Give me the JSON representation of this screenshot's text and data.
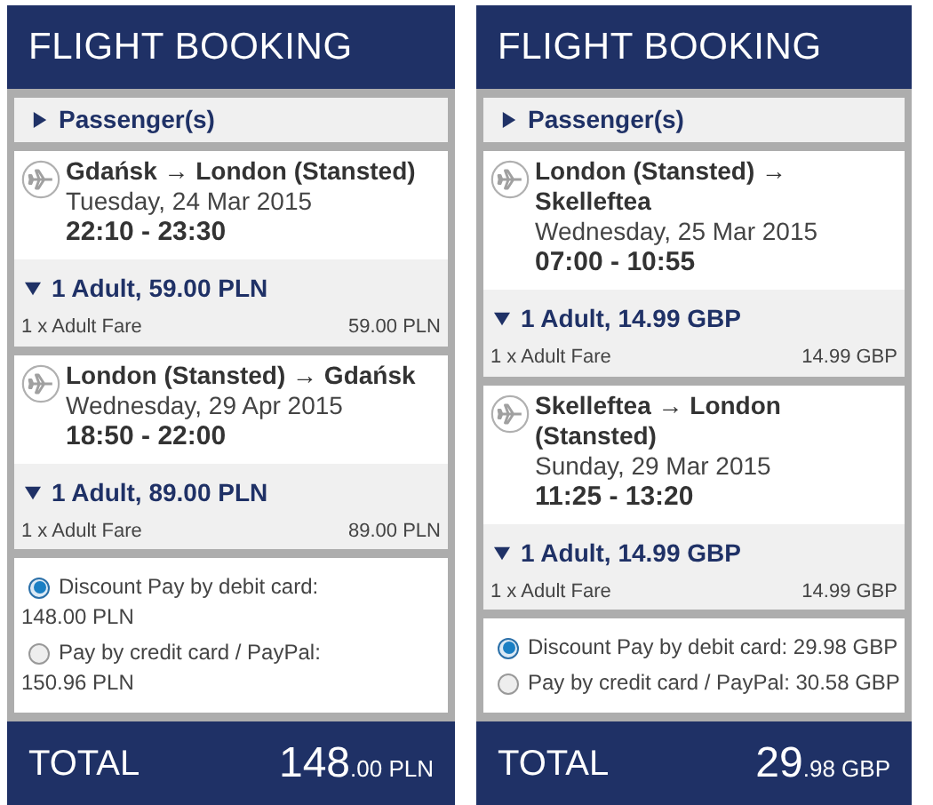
{
  "panels": [
    {
      "title": "FLIGHT BOOKING",
      "passengers": {
        "label": "Passenger(s)",
        "expanded": false
      },
      "flights": [
        {
          "route": "Gdańsk → London (Stansted)",
          "date": "Tuesday, 24 Mar 2015",
          "time": "22:10 - 23:30",
          "fare_summary": "1 Adult, 59.00 PLN",
          "expanded": true,
          "fare_label": "1 x Adult Fare",
          "fare_amount": "59.00 PLN"
        },
        {
          "route": "London (Stansted) → Gdańsk",
          "date": "Wednesday, 29 Apr 2015",
          "time": "18:50 - 22:00",
          "fare_summary": "1 Adult, 89.00 PLN",
          "expanded": true,
          "fare_label": "1 x Adult Fare",
          "fare_amount": "89.00 PLN"
        }
      ],
      "payment_options": [
        {
          "label": "Discount Pay by debit card:",
          "amount": "148.00 PLN",
          "selected": true
        },
        {
          "label": "Pay by credit card / PayPal:",
          "amount": "150.96 PLN",
          "selected": false
        }
      ],
      "total": {
        "label": "TOTAL",
        "amount": "148",
        "fraction": ".00 PLN"
      }
    },
    {
      "title": "FLIGHT BOOKING",
      "passengers": {
        "label": "Passenger(s)",
        "expanded": false
      },
      "flights": [
        {
          "route": "London (Stansted) → Skelleftea",
          "date": "Wednesday, 25 Mar 2015",
          "time": "07:00 - 10:55",
          "fare_summary": "1 Adult, 14.99 GBP",
          "expanded": true,
          "fare_label": "1 x Adult Fare",
          "fare_amount": "14.99 GBP"
        },
        {
          "route": "Skelleftea → London (Stansted)",
          "date": "Sunday, 29 Mar 2015",
          "time": "11:25 - 13:20",
          "fare_summary": "1 Adult, 14.99 GBP",
          "expanded": true,
          "fare_label": "1 x Adult Fare",
          "fare_amount": "14.99 GBP"
        }
      ],
      "payment_options": [
        {
          "label": "Discount Pay by debit card:",
          "amount": "29.98 GBP",
          "selected": true
        },
        {
          "label": "Pay by credit card / PayPal:",
          "amount": "30.58 GBP",
          "selected": false
        }
      ],
      "total": {
        "label": "TOTAL",
        "amount": "29",
        "fraction": ".98 GBP"
      }
    }
  ]
}
